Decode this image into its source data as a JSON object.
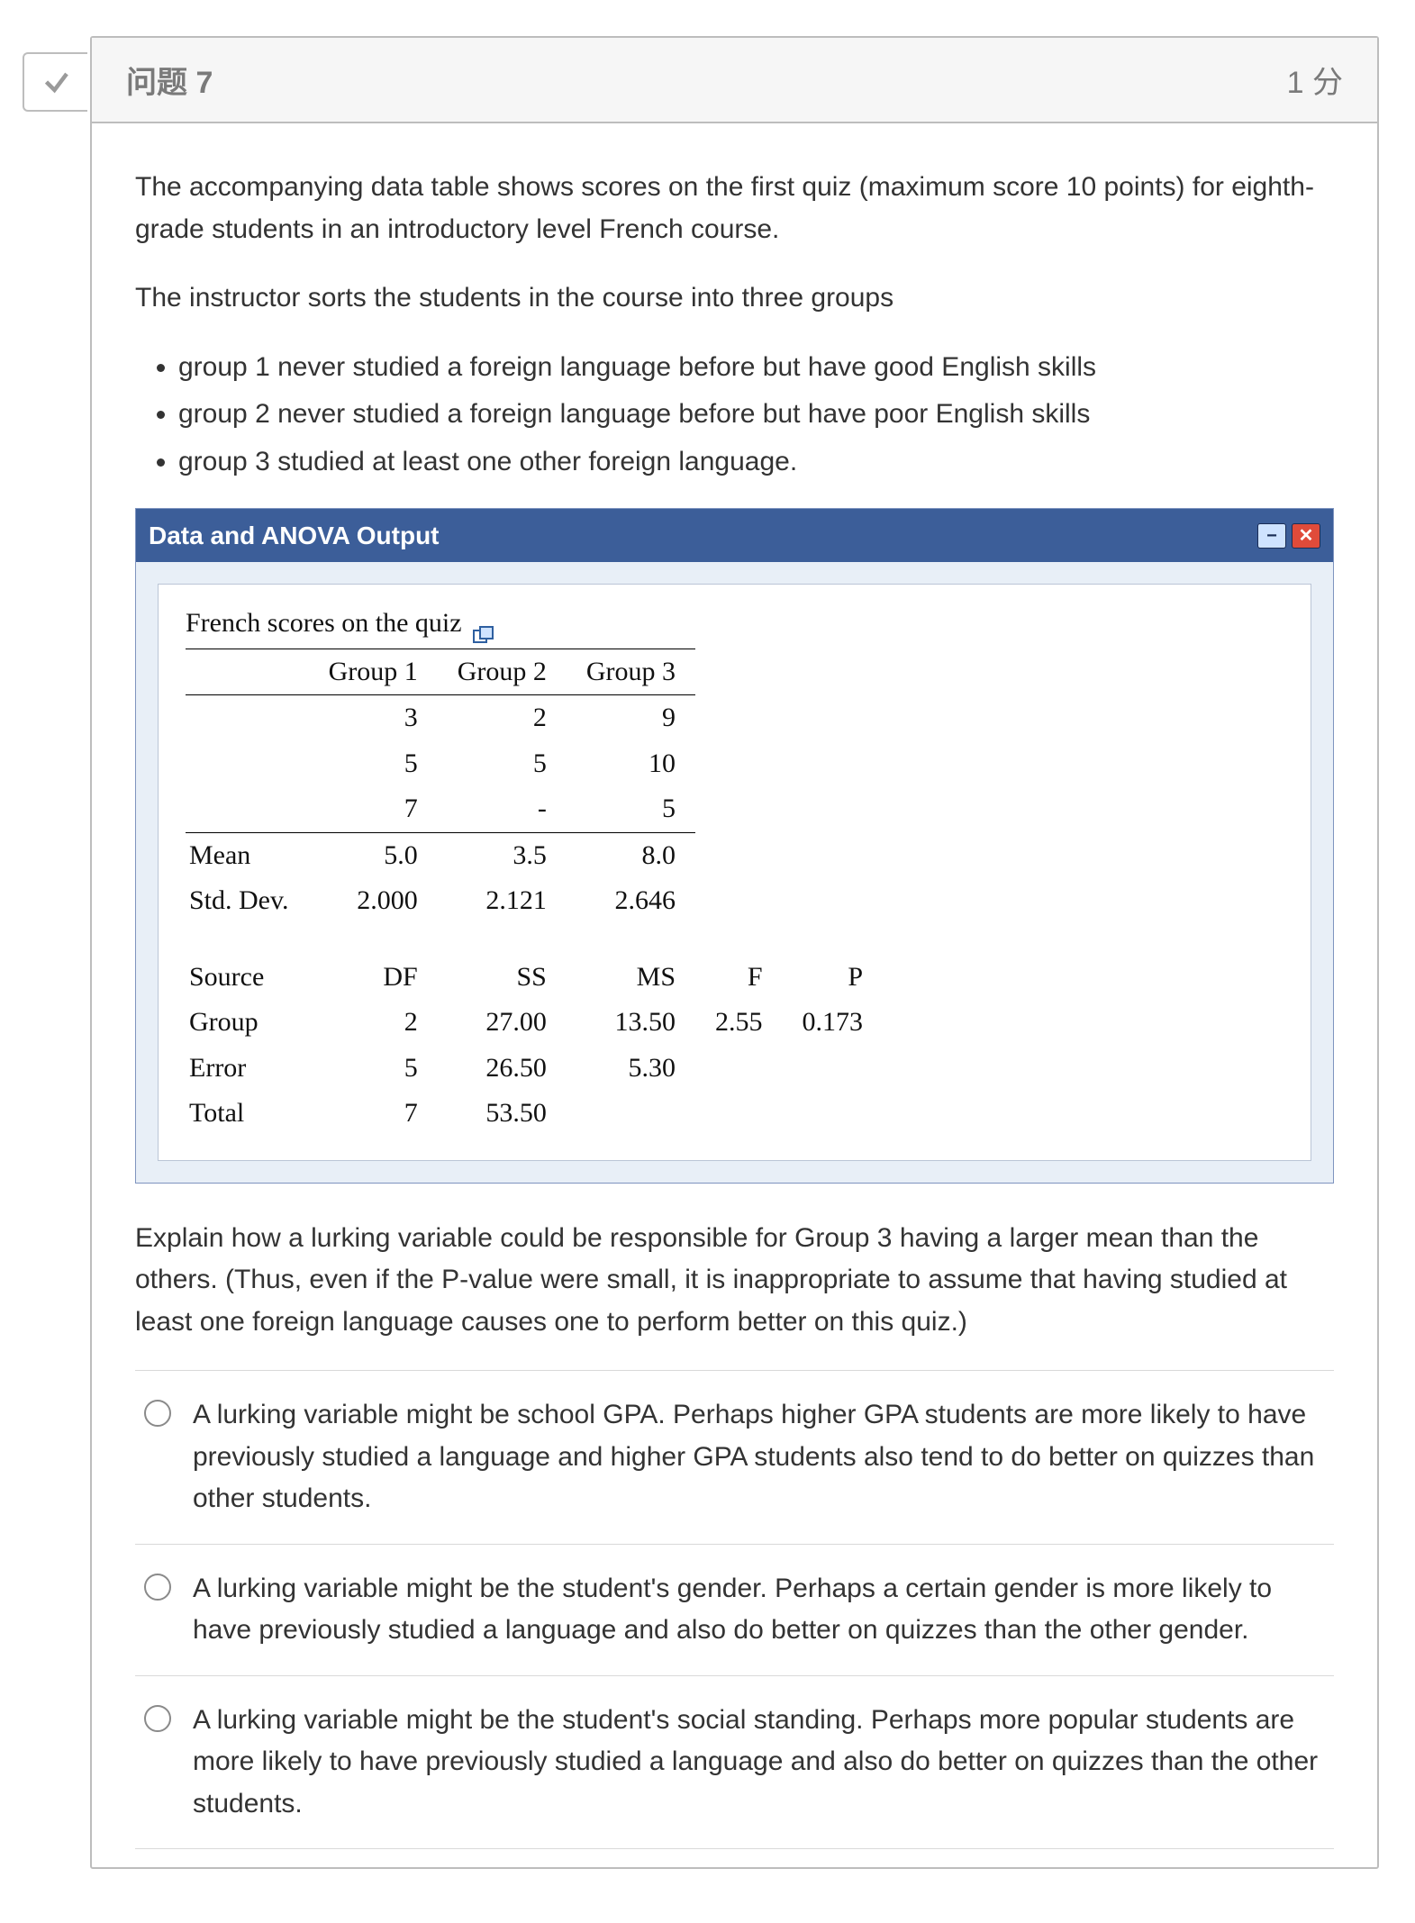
{
  "header": {
    "title": "问题 7",
    "points": "1 分"
  },
  "intro": {
    "p1": "The accompanying data table shows scores on the first quiz (maximum score 10 points) for eighth-grade students in an introductory level French course.",
    "p2": "The instructor sorts the students in the course into three groups",
    "bullets": [
      "group 1 never studied a foreign language before but have good English skills",
      "group 2 never studied a foreign language before but have poor English skills",
      "group 3 studied at least one other foreign language."
    ]
  },
  "panel": {
    "title": "Data and ANOVA Output",
    "minimize_icon": "minimize-icon",
    "close_icon": "close-icon",
    "popout_icon": "popout-icon",
    "scores_caption": "French scores on the quiz",
    "columns": {
      "c0": "",
      "c1": "Group 1",
      "c2": "Group 2",
      "c3": "Group 3"
    },
    "rows": [
      {
        "c0": "",
        "c1": "3",
        "c2": "2",
        "c3": "9"
      },
      {
        "c0": "",
        "c1": "5",
        "c2": "5",
        "c3": "10"
      },
      {
        "c0": "",
        "c1": "7",
        "c2": "-",
        "c3": "5"
      }
    ],
    "summary": [
      {
        "c0": "Mean",
        "c1": "5.0",
        "c2": "3.5",
        "c3": "8.0"
      },
      {
        "c0": "Std. Dev.",
        "c1": "2.000",
        "c2": "2.121",
        "c3": "2.646"
      }
    ],
    "anova_head": {
      "a0": "Source",
      "a1": "DF",
      "a2": "SS",
      "a3": "MS",
      "a4": "F",
      "a5": "P"
    },
    "anova": [
      {
        "a0": "Group",
        "a1": "2",
        "a2": "27.00",
        "a3": "13.50",
        "a4": "2.55",
        "a5": "0.173"
      },
      {
        "a0": "Error",
        "a1": "5",
        "a2": "26.50",
        "a3": "5.30",
        "a4": "",
        "a5": ""
      },
      {
        "a0": "Total",
        "a1": "7",
        "a2": "53.50",
        "a3": "",
        "a4": "",
        "a5": ""
      }
    ]
  },
  "question_tail": "Explain how a lurking variable could be responsible for Group 3 having a larger mean than the others.  (Thus, even if the P-value were small, it is inappropriate to assume that having studied at least one foreign language causes one to perform better on this quiz.)",
  "options": [
    "A lurking variable might be school GPA. Perhaps higher GPA students are more likely to have previously studied a language and higher GPA students also tend to do better on quizzes than other students.",
    "A lurking variable might be the student's gender. Perhaps a certain gender is more likely to have previously studied a language and also do better on quizzes than the other gender.",
    "A lurking variable might be the student's social standing. Perhaps more popular students are more likely to have previously studied a language and also do better on quizzes than the other students."
  ]
}
